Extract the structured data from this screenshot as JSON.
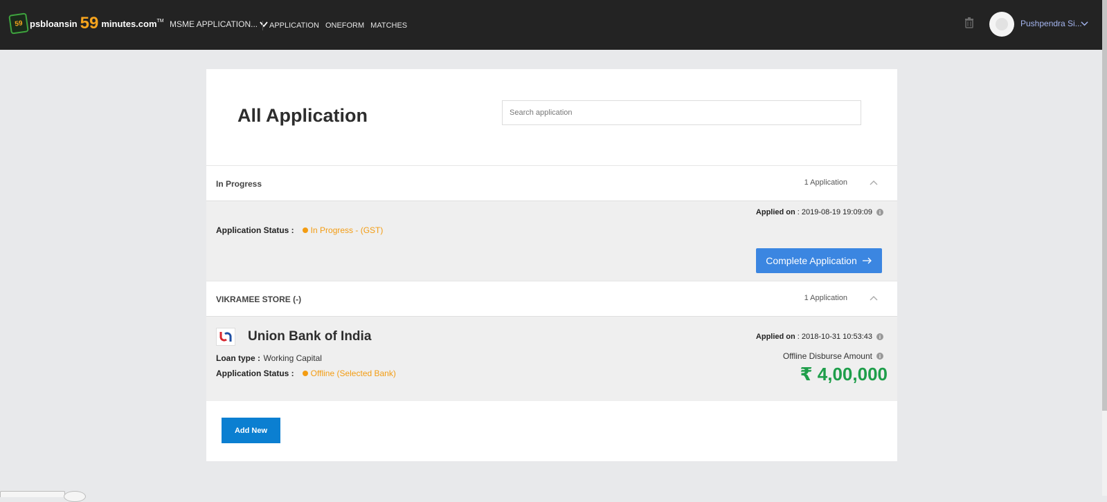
{
  "brand": {
    "badge": "59",
    "name_part1": "psbloansin",
    "name_number": "59",
    "name_part2": "minutes.com",
    "trademark": "TM"
  },
  "nav": {
    "dropdown_label": "MSME APPLICATION...",
    "links": [
      "APPLICATION",
      "ONEFORM",
      "MATCHES"
    ]
  },
  "user": {
    "name": "Pushpendra Si..."
  },
  "page": {
    "title": "All Application",
    "search_placeholder": "Search application"
  },
  "sections": [
    {
      "title": "In Progress",
      "count": "1 Application",
      "applied_label": "Applied on",
      "applied_value": ": 2019-08-19 19:09:09",
      "status_label": "Application Status :",
      "status_value": "In Progress - (GST)",
      "action_label": "Complete Application"
    },
    {
      "title": "VIKRAMEE STORE (-)",
      "count": "1 Application",
      "bank_name": "Union Bank of India",
      "loan_type_label": "Loan type :",
      "loan_type_value": "Working Capital",
      "status_label": "Application Status :",
      "status_value": "Offline (Selected Bank)",
      "applied_label": "Applied on",
      "applied_value": ": 2018-10-31 10:53:43",
      "amount_label": "Offline Disburse Amount",
      "amount_value": "₹ 4,00,000"
    }
  ],
  "add_button_label": "Add New",
  "colors": {
    "topbar": "#232323",
    "accent_blue": "#3b86e1",
    "status_orange": "#f39c12",
    "amount_green": "#1e9e4a",
    "brand_orange": "#f7a41d"
  },
  "icons": [
    "logo-icon",
    "chevron-down-icon",
    "trash-icon",
    "avatar",
    "chevron-up-icon",
    "info-icon",
    "arrow-right-icon",
    "bank-logo"
  ]
}
